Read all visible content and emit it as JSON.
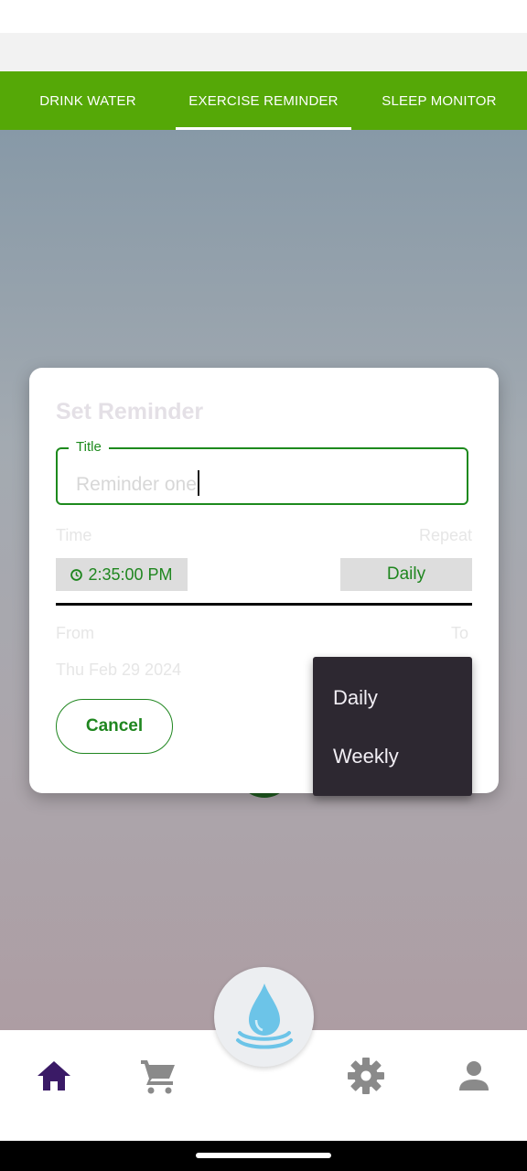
{
  "tabs": [
    {
      "label": "DRINK WATER",
      "active": false
    },
    {
      "label": "EXERCISE REMINDER",
      "active": true
    },
    {
      "label": "SLEEP MONITOR",
      "active": false
    }
  ],
  "dialog": {
    "heading": "Set Reminder",
    "title_field": {
      "label": "Title",
      "value": "Reminder one"
    },
    "time_label": "Time",
    "repeat_label": "Repeat",
    "time_value": "2:35:00 PM",
    "repeat_value": "Daily",
    "from_label": "From",
    "to_label": "To",
    "from_value": "Thu Feb 29 2024",
    "cancel_label": "Cancel"
  },
  "repeat_menu": {
    "options": [
      "Daily",
      "Weekly"
    ]
  },
  "bottom_nav": {
    "items": [
      {
        "icon": "home-icon",
        "active": true
      },
      {
        "icon": "cart-icon",
        "active": false
      },
      {
        "icon": "water-drop-icon",
        "active": false
      },
      {
        "icon": "gear-icon",
        "active": false
      },
      {
        "icon": "person-icon",
        "active": false
      }
    ]
  },
  "colors": {
    "tab_bar": "#55a807",
    "accent_green": "#1f861f",
    "nav_active": "#3a1a66",
    "nav_inactive": "#8a8a8a",
    "water_blue": "#6cc4e8"
  }
}
